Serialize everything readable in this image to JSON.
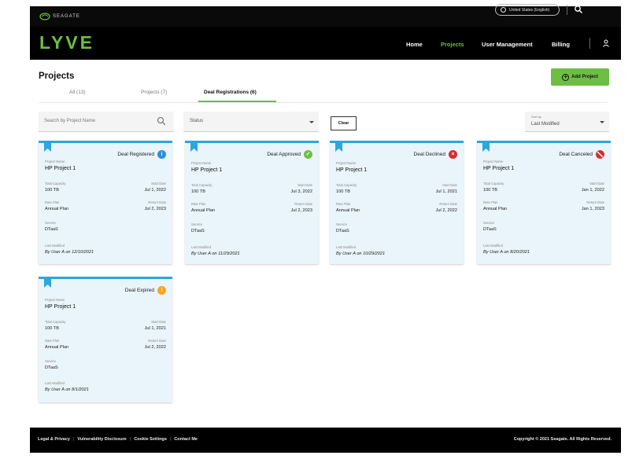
{
  "topbar": {
    "brand": "SEAGATE",
    "region": "United States (English)"
  },
  "nav": {
    "logo_text": "LYVE",
    "links": [
      {
        "label": "Home",
        "active": false
      },
      {
        "label": "Projects",
        "active": true
      },
      {
        "label": "User Management",
        "active": false
      },
      {
        "label": "Billing",
        "active": false
      }
    ]
  },
  "page": {
    "title": "Projects",
    "add_button": "Add Project"
  },
  "tabs": [
    {
      "label": "All (13)",
      "active": false
    },
    {
      "label": "Projects (7)",
      "active": false
    },
    {
      "label": "Deal Registrations (6)",
      "active": true
    }
  ],
  "filters": {
    "search_placeholder": "Search by Project Name",
    "status_placeholder": "Status",
    "clear_label": "Clear",
    "sort_label": "Sort by",
    "sort_value": "Last Modified"
  },
  "labels": {
    "project_name": "Project Name",
    "total_capacity": "Total Capacity",
    "start_date": "Start Date",
    "rate_plan": "Rate Plan",
    "return_date": "Return Date",
    "service": "Service",
    "last_modified": "Last Modified"
  },
  "cards": [
    {
      "status": "Deal Registered",
      "status_color": "#2f8fd8",
      "status_icon": "info-icon",
      "project_name": "HP Project 1",
      "total_capacity": "100 TB",
      "start_date": "Jul 1, 2022",
      "rate_plan": "Annual Plan",
      "return_date": "Jul 2, 2023",
      "service": "DTaaS",
      "last_modified": "By User A on 12/10/2021"
    },
    {
      "status": "Deal Approved",
      "status_color": "#6ebe44",
      "status_icon": "check-icon",
      "project_name": "HP Project 1",
      "total_capacity": "100 TB",
      "start_date": "Jul 3, 2022",
      "rate_plan": "Annual Plan",
      "return_date": "Jul 2, 2023",
      "service": "DTaaS",
      "last_modified": "By User A on 11/29/2021"
    },
    {
      "status": "Deal Declined",
      "status_color": "#d92b2b",
      "status_icon": "close-icon",
      "project_name": "HP Project 1",
      "total_capacity": "100 TB",
      "start_date": "Jul 1, 2021",
      "rate_plan": "Annual Plan",
      "return_date": "Jul 2, 2022",
      "service": "DTaaS",
      "last_modified": "By User A on 10/29/2021"
    },
    {
      "status": "Deal Canceled",
      "status_color": "#d92b2b",
      "status_icon": "cancel-icon",
      "project_name": "HP Project 1",
      "total_capacity": "100 TB",
      "start_date": "Jan 1, 2022",
      "rate_plan": "Annual Plan",
      "return_date": "Jan 1, 2023",
      "service": "DTaaS",
      "last_modified": "By User A on 8/20/2021"
    },
    {
      "status": "Deal Expired",
      "status_color": "#f5a623",
      "status_icon": "alert-icon",
      "project_name": "HP Project 1",
      "total_capacity": "100 TB",
      "start_date": "Jul 1, 2021",
      "rate_plan": "Annual Plan",
      "return_date": "Jul 2, 2022",
      "service": "DTaaS",
      "last_modified": "By User A on 8/1/2021"
    }
  ],
  "footer": {
    "links": [
      "Legal & Privacy",
      "Vulnerability Disclosure",
      "Cookie Settings",
      "Contact Me"
    ],
    "copyright": "Copyright © 2021 Seagate. All Rights Reserved."
  }
}
